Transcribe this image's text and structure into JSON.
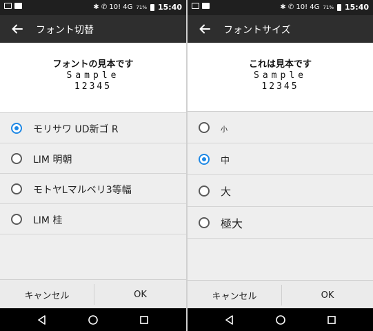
{
  "status_bar": {
    "time": "15:40",
    "battery_percent": "71%",
    "signal_glyphs": "✱ ✆ 10! 4G"
  },
  "left": {
    "title": "フォント切替",
    "sample": {
      "line1": "フォントの見本です",
      "line2": "Sample",
      "line3": "12345"
    },
    "options": [
      {
        "label": "モリサワ UD新ゴ R",
        "selected": true
      },
      {
        "label": "LIM 明朝",
        "selected": false
      },
      {
        "label": "モトヤLマルベリ3等幅",
        "selected": false
      },
      {
        "label": "LIM 桂",
        "selected": false
      }
    ],
    "cancel_label": "キャンセル",
    "ok_label": "OK"
  },
  "right": {
    "title": "フォントサイズ",
    "sample": {
      "line1": "これは見本です",
      "line2": "Sample",
      "line3": "12345"
    },
    "options": [
      {
        "label": "小",
        "selected": false
      },
      {
        "label": "中",
        "selected": true
      },
      {
        "label": "大",
        "selected": false
      },
      {
        "label": "極大",
        "selected": false
      }
    ],
    "cancel_label": "キャンセル",
    "ok_label": "OK"
  },
  "colors": {
    "accent": "#1e88e5",
    "appbar": "#2e2e2e",
    "statusbar": "#1f1f1f",
    "navbar": "#000000",
    "list_bg": "#eeeeee"
  }
}
